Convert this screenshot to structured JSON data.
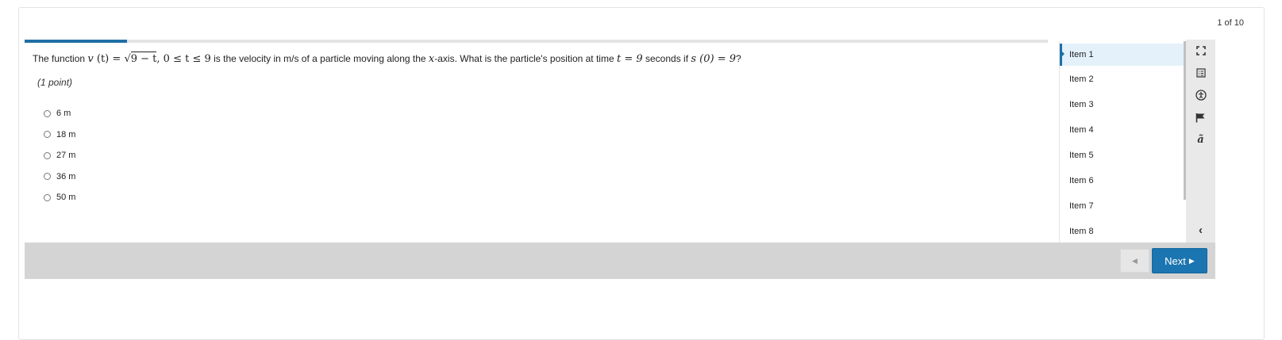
{
  "header": {
    "counter": "1 of 10"
  },
  "progress": {
    "fraction": 0.1
  },
  "question": {
    "prefix": "The function",
    "fn": "v",
    "paren_t": "(t)",
    "eq": "=",
    "radicand": "9 − t",
    "range": ", 0 ≤ t ≤ 9",
    "middle": "is the velocity in m/s of a particle moving along the",
    "axis_var": "x",
    "middle2": "-axis. What is the particle's position at time",
    "time_eq": "t = 9",
    "middle3": "seconds if",
    "init": "s (0) = 9",
    "suffix": "?",
    "points": "(1 point)"
  },
  "options": [
    {
      "label": "6 m"
    },
    {
      "label": "18 m"
    },
    {
      "label": "27 m"
    },
    {
      "label": "36 m"
    },
    {
      "label": "50 m"
    }
  ],
  "items": [
    {
      "label": "Item 1"
    },
    {
      "label": "Item 2"
    },
    {
      "label": "Item 3"
    },
    {
      "label": "Item 4"
    },
    {
      "label": "Item 5"
    },
    {
      "label": "Item 6"
    },
    {
      "label": "Item 7"
    },
    {
      "label": "Item 8"
    }
  ],
  "toolbar": {
    "icons": [
      "fullscreen-icon",
      "reference-sheet-icon",
      "accessibility-icon",
      "flag-icon",
      "translate-icon",
      "collapse-icon"
    ],
    "collapse_glyph": "‹"
  },
  "nav": {
    "next_label": "Next",
    "prev_glyph": "◀",
    "next_glyph": "▶"
  },
  "colors": {
    "accent": "#1b75b0",
    "active_item_bg": "#e4f1fb",
    "footer_bg": "#d4d4d4"
  }
}
